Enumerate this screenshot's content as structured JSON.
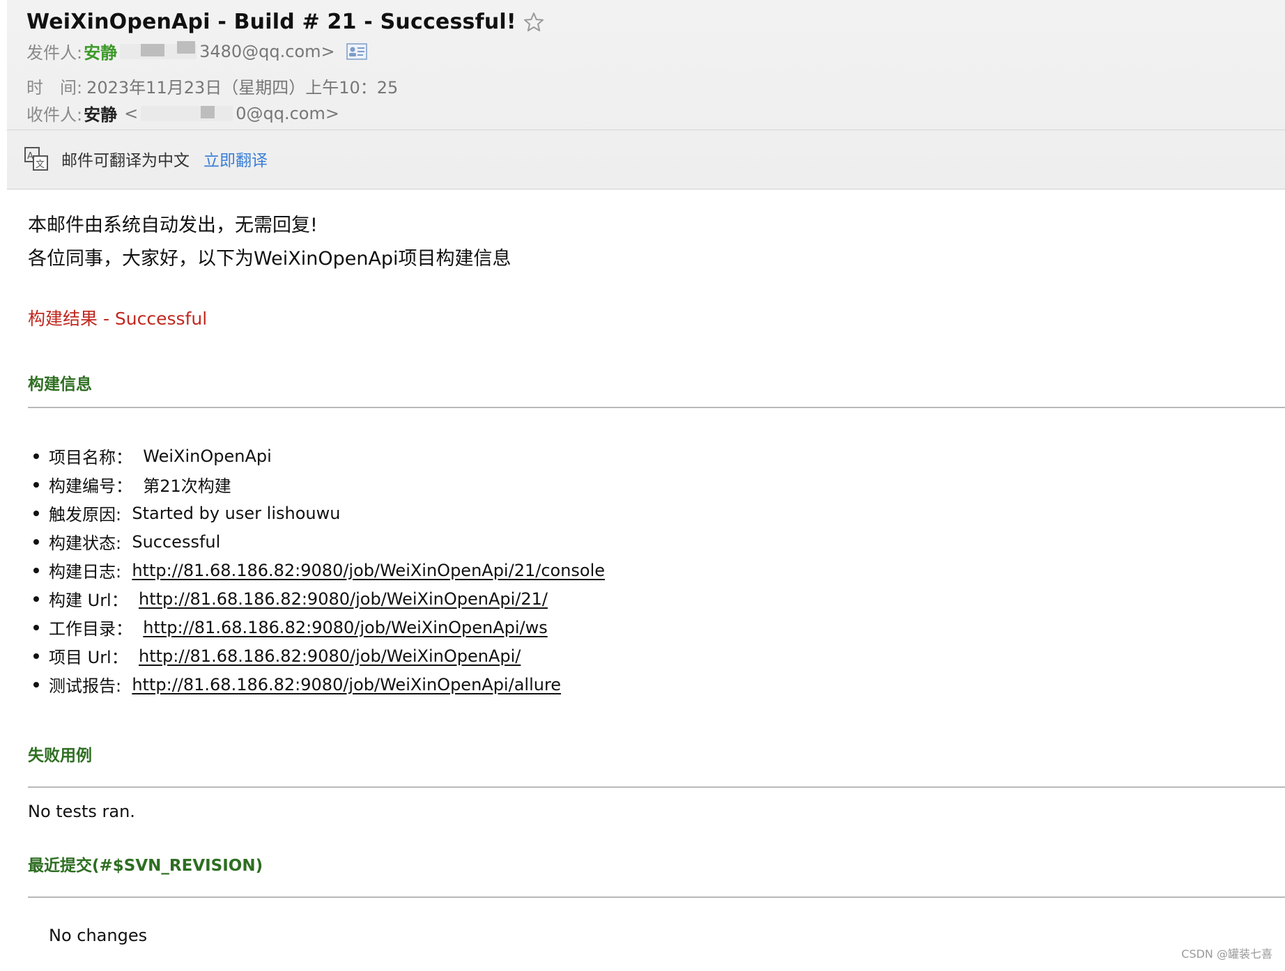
{
  "header": {
    "subject": "WeiXinOpenApi - Build # 21 - Successful!",
    "sender_label": "发件人:",
    "sender_name": "安静",
    "sender_email_tail": "3480@qq.com>",
    "time_label": "时　间:",
    "time_value": "2023年11月23日（星期四）上午10：25",
    "recipient_label": "收件人:",
    "recipient_name": "安静",
    "recipient_open": "<",
    "recipient_email_tail": "0@qq.com>"
  },
  "translate": {
    "text": "邮件可翻译为中文",
    "link": "立即翻译"
  },
  "body": {
    "intro_line1": "本邮件由系统自动发出，无需回复!",
    "intro_line2": "各位同事，大家好，以下为WeiXinOpenApi项目构建信息",
    "result": "构建结果 - Successful",
    "build_info_title": "构建信息",
    "items": [
      {
        "label": "项目名称：  ",
        "value": "WeiXinOpenApi"
      },
      {
        "label": "构建编号：  ",
        "value": "第21次构建"
      },
      {
        "label": "触发原因:  ",
        "value": "Started by user lishouwu"
      },
      {
        "label": "构建状态:  ",
        "value": "Successful"
      },
      {
        "label": "构建日志:  ",
        "value": "http://81.68.186.82:9080/job/WeiXinOpenApi/21/console"
      },
      {
        "label": "构建 Url：  ",
        "value": "http://81.68.186.82:9080/job/WeiXinOpenApi/21/"
      },
      {
        "label": "工作目录：  ",
        "value": "http://81.68.186.82:9080/job/WeiXinOpenApi/ws"
      },
      {
        "label": "项目 Url：  ",
        "value": "http://81.68.186.82:9080/job/WeiXinOpenApi/"
      },
      {
        "label": "测试报告:  ",
        "value": "http://81.68.186.82:9080/job/WeiXinOpenApi/allure"
      }
    ],
    "failed_title": "失败用例",
    "failed_text": "No tests ran.",
    "commits_title": "最近提交(#$SVN_REVISION)",
    "commits_text": "No changes"
  },
  "watermark": "CSDN @罐装七喜",
  "colors": {
    "sender_green": "#3d9a2a",
    "link_blue": "#3b7fd6",
    "result_red": "#c0281f",
    "section_green": "#2e6e22"
  },
  "icons": [
    "star-icon",
    "contact-card-icon",
    "translate-icon"
  ]
}
